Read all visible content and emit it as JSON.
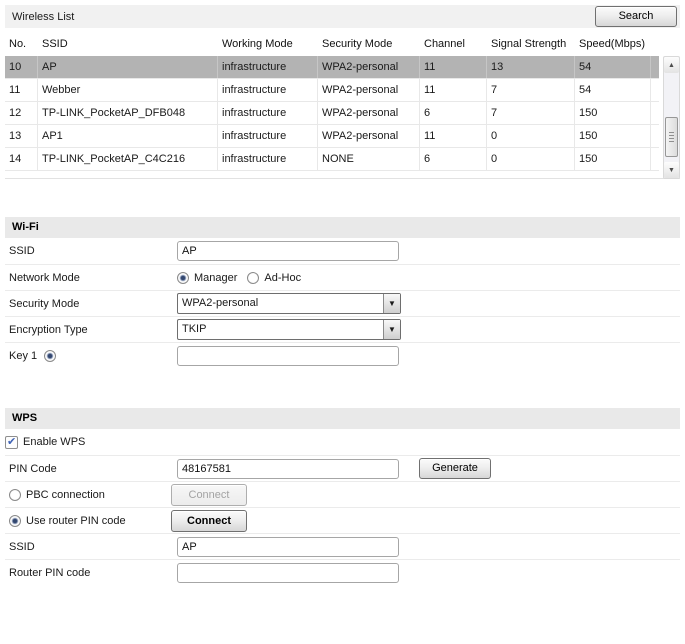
{
  "wireless_list": {
    "title": "Wireless List",
    "search_button": "Search",
    "columns": [
      "No.",
      "SSID",
      "Working Mode",
      "Security Mode",
      "Channel",
      "Signal Strength",
      "Speed(Mbps)"
    ],
    "rows": [
      {
        "no": "10",
        "ssid": "AP",
        "working_mode": "infrastructure",
        "security_mode": "WPA2-personal",
        "channel": "11",
        "signal": "13",
        "speed": "54",
        "selected": true
      },
      {
        "no": "11",
        "ssid": "Webber",
        "working_mode": "infrastructure",
        "security_mode": "WPA2-personal",
        "channel": "11",
        "signal": "7",
        "speed": "54",
        "selected": false
      },
      {
        "no": "12",
        "ssid": "TP-LINK_PocketAP_DFB048",
        "working_mode": "infrastructure",
        "security_mode": "WPA2-personal",
        "channel": "6",
        "signal": "7",
        "speed": "150",
        "selected": false
      },
      {
        "no": "13",
        "ssid": "AP1",
        "working_mode": "infrastructure",
        "security_mode": "WPA2-personal",
        "channel": "11",
        "signal": "0",
        "speed": "150",
        "selected": false
      },
      {
        "no": "14",
        "ssid": "TP-LINK_PocketAP_C4C216",
        "working_mode": "infrastructure",
        "security_mode": "NONE",
        "channel": "6",
        "signal": "0",
        "speed": "150",
        "selected": false
      }
    ],
    "scrollbar": {
      "up_glyph": "▲",
      "down_glyph": "▼"
    }
  },
  "wifi": {
    "section_title": "Wi-Fi",
    "ssid_label": "SSID",
    "ssid_value": "AP",
    "network_mode_label": "Network Mode",
    "network_mode_options": [
      {
        "label": "Manager",
        "selected": true
      },
      {
        "label": "Ad-Hoc",
        "selected": false
      }
    ],
    "security_mode_label": "Security Mode",
    "security_mode_value": "WPA2-personal",
    "encryption_type_label": "Encryption Type",
    "encryption_type_value": "TKIP",
    "key1_label": "Key 1",
    "key1_selected": true,
    "key1_value": "",
    "dropdown_glyph": "▼"
  },
  "wps": {
    "section_title": "WPS",
    "enable_label": "Enable WPS",
    "enable_checked": true,
    "pin_code_label": "PIN Code",
    "pin_code_value": "48167581",
    "generate_button": "Generate",
    "pbc_label": "PBC connection",
    "pbc_selected": false,
    "pbc_connect_button": "Connect",
    "use_router_pin_label": "Use router PIN code",
    "use_router_pin_selected": true,
    "router_connect_button": "Connect",
    "ssid_label": "SSID",
    "ssid_value": "AP",
    "router_pin_label": "Router PIN code",
    "router_pin_value": ""
  }
}
